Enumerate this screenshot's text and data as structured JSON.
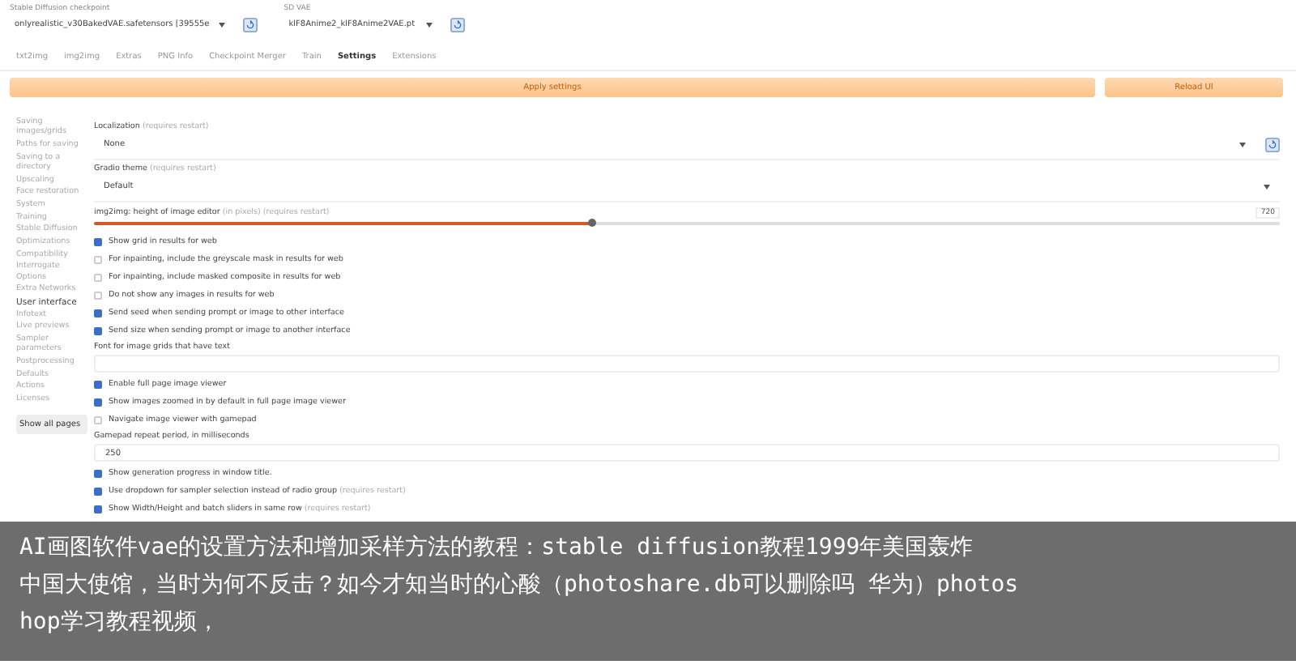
{
  "header": {
    "checkpoint": {
      "label": "Stable Diffusion checkpoint",
      "value": "onlyrealistic_v30BakedVAE.safetensors [39555e"
    },
    "vae": {
      "label": "SD VAE",
      "value": "klF8Anime2_klF8Anime2VAE.pt"
    }
  },
  "tabs": [
    {
      "label": "txt2img",
      "selected": false
    },
    {
      "label": "img2img",
      "selected": false
    },
    {
      "label": "Extras",
      "selected": false
    },
    {
      "label": "PNG Info",
      "selected": false
    },
    {
      "label": "Checkpoint Merger",
      "selected": false
    },
    {
      "label": "Train",
      "selected": false
    },
    {
      "label": "Settings",
      "selected": true
    },
    {
      "label": "Extensions",
      "selected": false
    }
  ],
  "actions": {
    "apply": "Apply settings",
    "reload": "Reload UI"
  },
  "sidebar": {
    "items": [
      {
        "label": "Saving images/grids",
        "selected": false
      },
      {
        "label": "Paths for saving",
        "selected": false
      },
      {
        "label": "Saving to a directory",
        "selected": false
      },
      {
        "label": "Upscaling",
        "selected": false
      },
      {
        "label": "Face restoration",
        "selected": false
      },
      {
        "label": "System",
        "selected": false
      },
      {
        "label": "Training",
        "selected": false
      },
      {
        "label": "Stable Diffusion",
        "selected": false
      },
      {
        "label": "Optimizations",
        "selected": false
      },
      {
        "label": "Compatibility",
        "selected": false
      },
      {
        "label": "Interrogate Options",
        "selected": false
      },
      {
        "label": "Extra Networks",
        "selected": false
      },
      {
        "label": "User interface",
        "selected": true
      },
      {
        "label": "Infotext",
        "selected": false
      },
      {
        "label": "Live previews",
        "selected": false
      },
      {
        "label": "Sampler parameters",
        "selected": false
      },
      {
        "label": "Postprocessing",
        "selected": false
      },
      {
        "label": "Defaults",
        "selected": false
      },
      {
        "label": "Actions",
        "selected": false
      },
      {
        "label": "Licenses",
        "selected": false
      }
    ],
    "show_all": "Show all pages"
  },
  "settings": [
    {
      "kind": "dropdown",
      "label": "Localization",
      "note": "(requires restart)",
      "value": "None",
      "refresh": true
    },
    {
      "kind": "dropdown",
      "label": "Gradio theme",
      "note": "(requires restart)",
      "value": "Default"
    },
    {
      "kind": "slider",
      "label": "img2img: height of image editor",
      "note": "(in pixels) (requires restart)",
      "level": 0.42,
      "value": "720"
    },
    {
      "kind": "checkbox",
      "label": "Show grid in results for web",
      "checked": true
    },
    {
      "kind": "checkbox",
      "label": "For inpainting, include the greyscale mask in results for web",
      "checked": false
    },
    {
      "kind": "checkbox",
      "label": "For inpainting, include masked composite in results for web",
      "checked": false
    },
    {
      "kind": "checkbox",
      "label": "Do not show any images in results for web",
      "checked": false
    },
    {
      "kind": "checkbox",
      "label": "Send seed when sending prompt or image to other interface",
      "checked": true
    },
    {
      "kind": "checkbox",
      "label": "Send size when sending prompt or image to another interface",
      "checked": true
    },
    {
      "kind": "textbox",
      "label": "Font for image grids that have text"
    },
    {
      "kind": "checkbox",
      "label": "Enable full page image viewer",
      "checked": true
    },
    {
      "kind": "checkbox",
      "label": "Show images zoomed in by default in full page image viewer",
      "checked": true
    },
    {
      "kind": "checkbox",
      "label": "Navigate image viewer with gamepad",
      "checked": false
    },
    {
      "kind": "number",
      "label": "Gamepad repeat period, in milliseconds",
      "value": "250"
    },
    {
      "kind": "checkbox",
      "label": "Show generation progress in window title.",
      "checked": true
    },
    {
      "kind": "checkbox",
      "label": "Use dropdown for sampler selection instead of radio group",
      "note": "(requires restart)",
      "checked": true
    },
    {
      "kind": "checkbox",
      "label": "Show Width/Height and batch sliders in same row",
      "note": "(requires restart)",
      "checked": true
    }
  ],
  "caption": {
    "lines": [
      "AI画图软件vae的设置方法和增加采样方法的教程：stable diffusion教程1999年美国轰炸",
      "中国大使馆，当时为何不反击？如今才知当时的心酸（photoshare.db可以删除吗 华为）photos",
      "hop学习教程视频，"
    ]
  }
}
